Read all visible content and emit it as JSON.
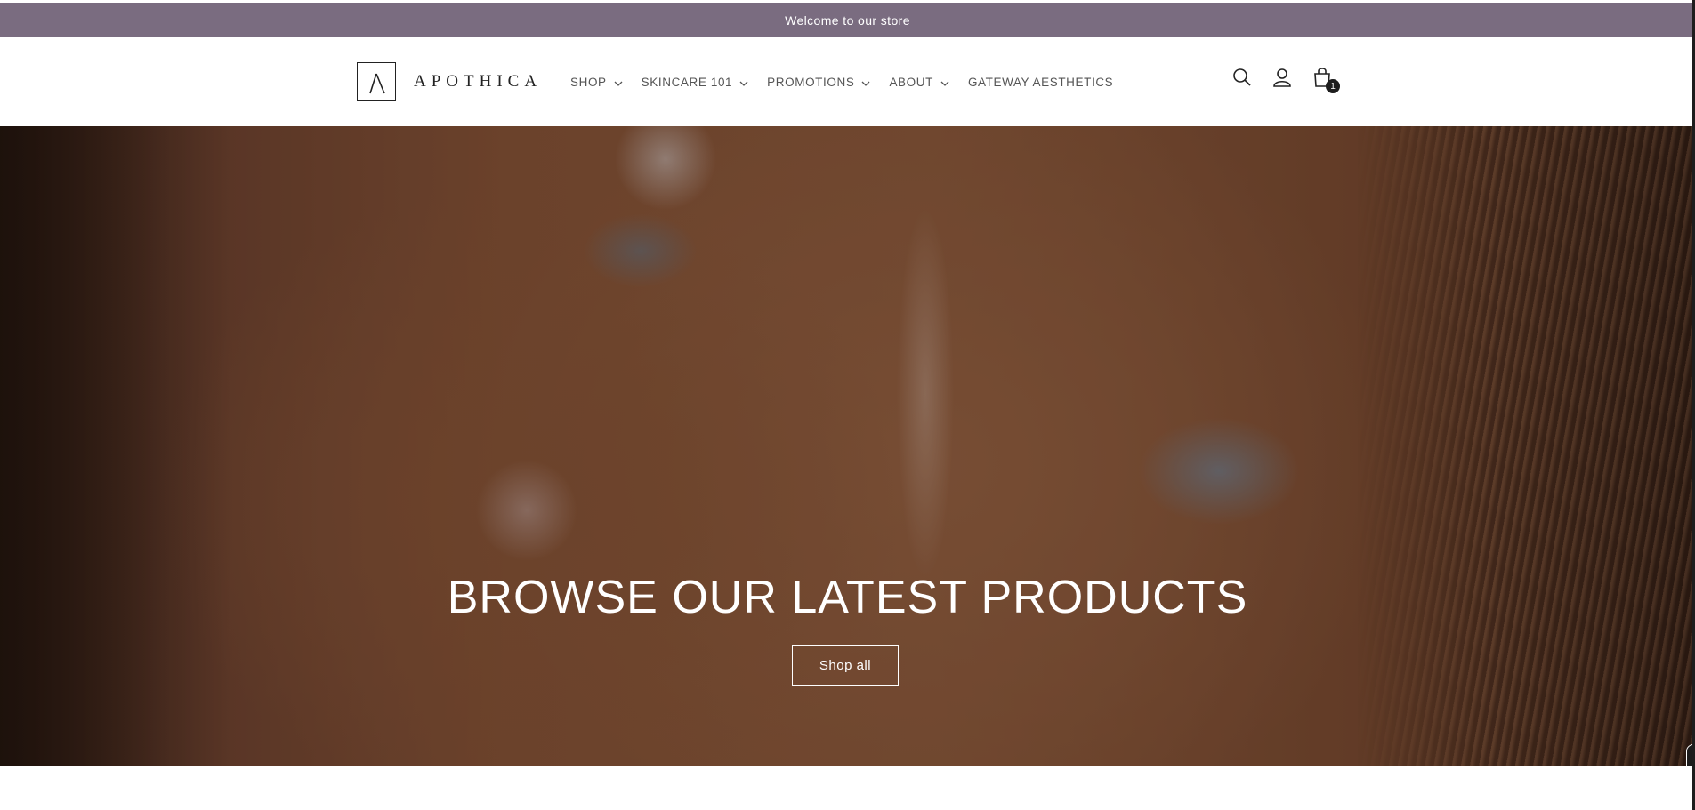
{
  "announcement": {
    "text": "Welcome to our store"
  },
  "brand": {
    "name": "APOTHICA"
  },
  "nav": {
    "items": [
      {
        "label": "SHOP",
        "has_dropdown": true
      },
      {
        "label": "SKINCARE 101",
        "has_dropdown": true
      },
      {
        "label": "PROMOTIONS",
        "has_dropdown": true
      },
      {
        "label": "ABOUT",
        "has_dropdown": true
      },
      {
        "label": "GATEWAY AESTHETICS",
        "has_dropdown": false
      }
    ]
  },
  "header_icons": {
    "search": "search-icon",
    "account": "account-icon",
    "cart": "cart-icon",
    "cart_count": "1"
  },
  "hero": {
    "title": "BROWSE OUR LATEST PRODUCTS",
    "button_label": "Shop all"
  },
  "colors": {
    "announcement_bg": "#7a6c80",
    "text_dark": "#222222",
    "nav_text": "#555555",
    "white": "#ffffff"
  }
}
